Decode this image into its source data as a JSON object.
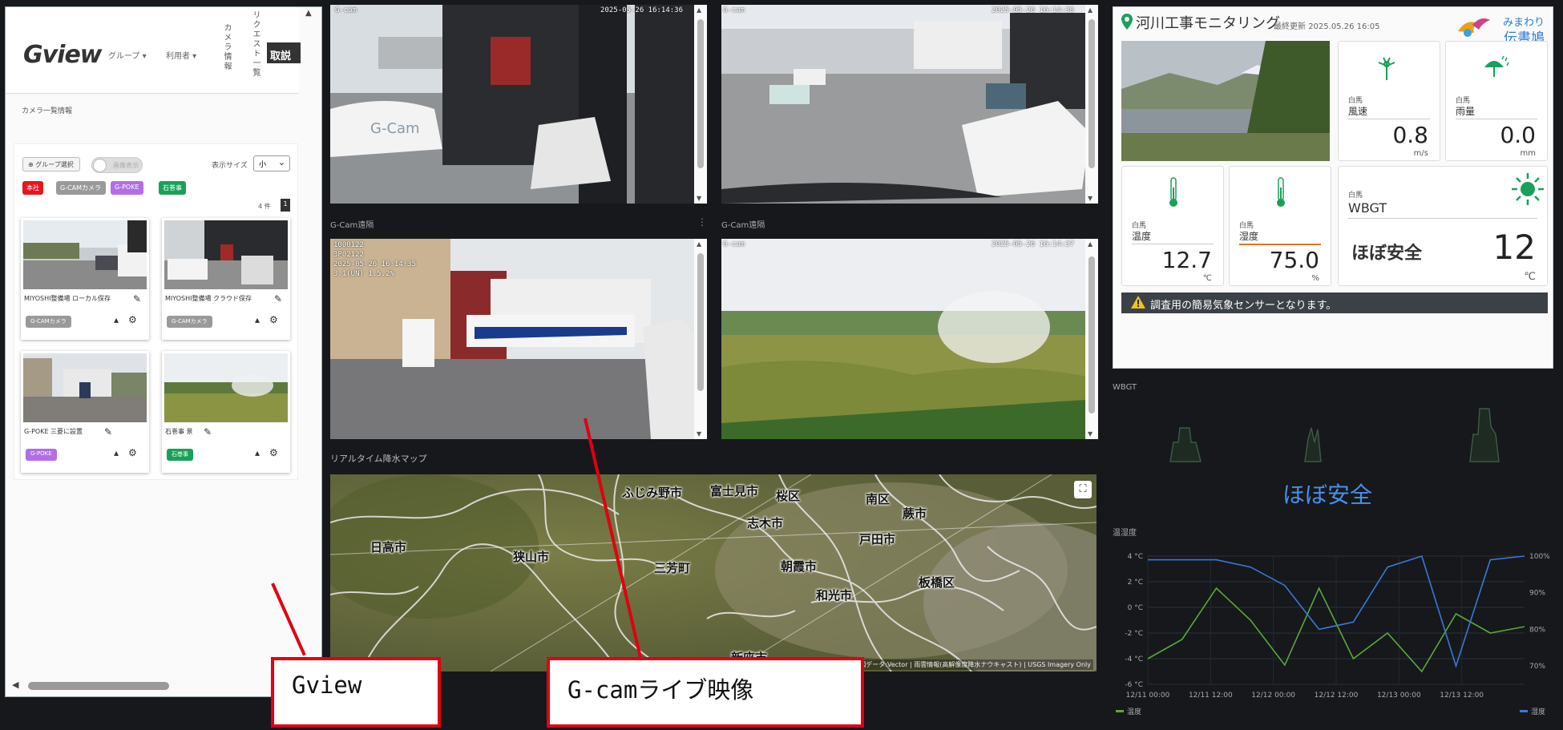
{
  "gview": {
    "logo": "Gview",
    "menu_group": "グループ ▾",
    "menu_user": "利用者 ▾",
    "menu_camera_info": "カメラ情報",
    "menu_request_list": "リクエスト一覧",
    "menu_cancel": "取説",
    "breadcrumb": "カメラ一覧情報",
    "group_select_label": "グループ選択",
    "toggle_label": "画像表示",
    "display_size_label": "表示サイズ",
    "display_size_value": "小",
    "tags": [
      {
        "label": "本社",
        "color": "#e8141e"
      },
      {
        "label": "G-CAMカメラ",
        "color": "#9a9a9a"
      },
      {
        "label": "G-POKE",
        "color": "#b26ee8"
      },
      {
        "label": "石巻事",
        "color": "#1aa058"
      }
    ],
    "count_text": "4 件",
    "page": "1",
    "thumbs": [
      {
        "name": "MIYOSHI整備場 ローカル保存",
        "tag": "G-CAMカメラ",
        "tag_color": "#9a9a9a"
      },
      {
        "name": "MIYOSHI整備場 クラウド保存",
        "tag": "G-CAMカメラ",
        "tag_color": "#9a9a9a"
      },
      {
        "name": "G-POKE 三菱に設置",
        "tag": "G-POKE",
        "tag_color": "#b26ee8"
      },
      {
        "name": "石巻事 景",
        "tag": "石巻事",
        "tag_color": "#1aa058"
      }
    ]
  },
  "cams": {
    "top_left_label": "G-cam",
    "top_left_ts": "2025-05-26 16:14:36",
    "top_right_label": "G-cam",
    "top_right_ts": "2025-05-26 16:14:36",
    "mid_left_title": "G-Cam遠隔",
    "mid_left_overlay": [
      "1000122",
      "3P02122",
      "2025-05-26 16:14:35",
      "3.1(UN) 1.5.2%"
    ],
    "mid_right_title": "G-Cam遠隔",
    "mid_right_label": "G-cam",
    "mid_right_ts": "2025-05-26 16:14:37"
  },
  "map": {
    "title": "リアルタイム降水マップ",
    "cities": [
      "ふじみ野市",
      "富士見市",
      "桜区",
      "南区",
      "蕨市",
      "志木市",
      "日高市",
      "狭山市",
      "三芳町",
      "朝霞市",
      "戸田市",
      "和光市",
      "板橋区",
      "新座市"
    ],
    "attribution": "地図データ:Vector | 雨雲情報(高解像度降水ナウキャスト) | USGS Imagery Only"
  },
  "weather": {
    "title": "河川工事モニタリング",
    "updated_label": "最終更新",
    "updated_value": "2025.05.26 16:05",
    "brand_line1": "みまわり",
    "brand_line2": "伝書鳩",
    "tiles": [
      {
        "sub": "白馬",
        "label": "風速",
        "value": "0.8",
        "unit": "m/s",
        "icon": "wind-icon"
      },
      {
        "sub": "白馬",
        "label": "雨量",
        "value": "0.0",
        "unit": "mm",
        "icon": "umbrella-rain-icon"
      },
      {
        "sub": "白馬",
        "label": "温度",
        "value": "12.7",
        "unit": "℃",
        "icon": "thermometer-icon"
      },
      {
        "sub": "白馬",
        "label": "湿度",
        "value": "75.0",
        "unit": "%",
        "icon": "thermometer-icon"
      },
      {
        "sub": "白馬",
        "label": "WBGT",
        "value": "12",
        "unit": "℃",
        "status": "ほぼ安全",
        "icon": "sun-icon"
      }
    ],
    "alert": "調査用の簡易気象センサーとなります。",
    "accent": "#1aa058"
  },
  "dark": {
    "wbgt_label": "WBGT",
    "status": "ほぼ安全",
    "temp_label": "温湿度",
    "legend_temp": "温度",
    "legend_humid": "湿度",
    "left_ticks": [
      "4 °C",
      "2 °C",
      "0 °C",
      "-2 °C",
      "-4 °C",
      "-6 °C"
    ],
    "right_ticks": [
      "100%",
      "90%",
      "80%",
      "70%"
    ],
    "x_ticks": [
      "12/11 00:00",
      "12/11 12:00",
      "12/12 00:00",
      "12/12 12:00",
      "12/13 00:00",
      "12/13 12:00"
    ]
  },
  "chart_data": {
    "type": "line",
    "x": [
      "12/11 00:00",
      "12/11 06:00",
      "12/11 12:00",
      "12/11 18:00",
      "12/12 00:00",
      "12/12 06:00",
      "12/12 12:00",
      "12/12 18:00",
      "12/13 00:00",
      "12/13 06:00",
      "12/13 12:00",
      "12/13 18:00"
    ],
    "series": [
      {
        "name": "温度",
        "axis": "left",
        "color": "#5aa83a",
        "values": [
          -4,
          -2.5,
          1.5,
          -1,
          -4.5,
          1.5,
          -4,
          -2,
          -5,
          -0.5,
          -2,
          -1.5
        ]
      },
      {
        "name": "湿度",
        "axis": "right",
        "color": "#3a78d8",
        "values": [
          99,
          99,
          99,
          97,
          92,
          80,
          82,
          97,
          100,
          70,
          99,
          100
        ]
      }
    ],
    "ylim_left": [
      -6,
      4
    ],
    "ylim_right": [
      65,
      100
    ],
    "legend_position": "bottom"
  },
  "callouts": {
    "gview_label": "Gview",
    "gcam_label": "G-camライブ映像"
  }
}
